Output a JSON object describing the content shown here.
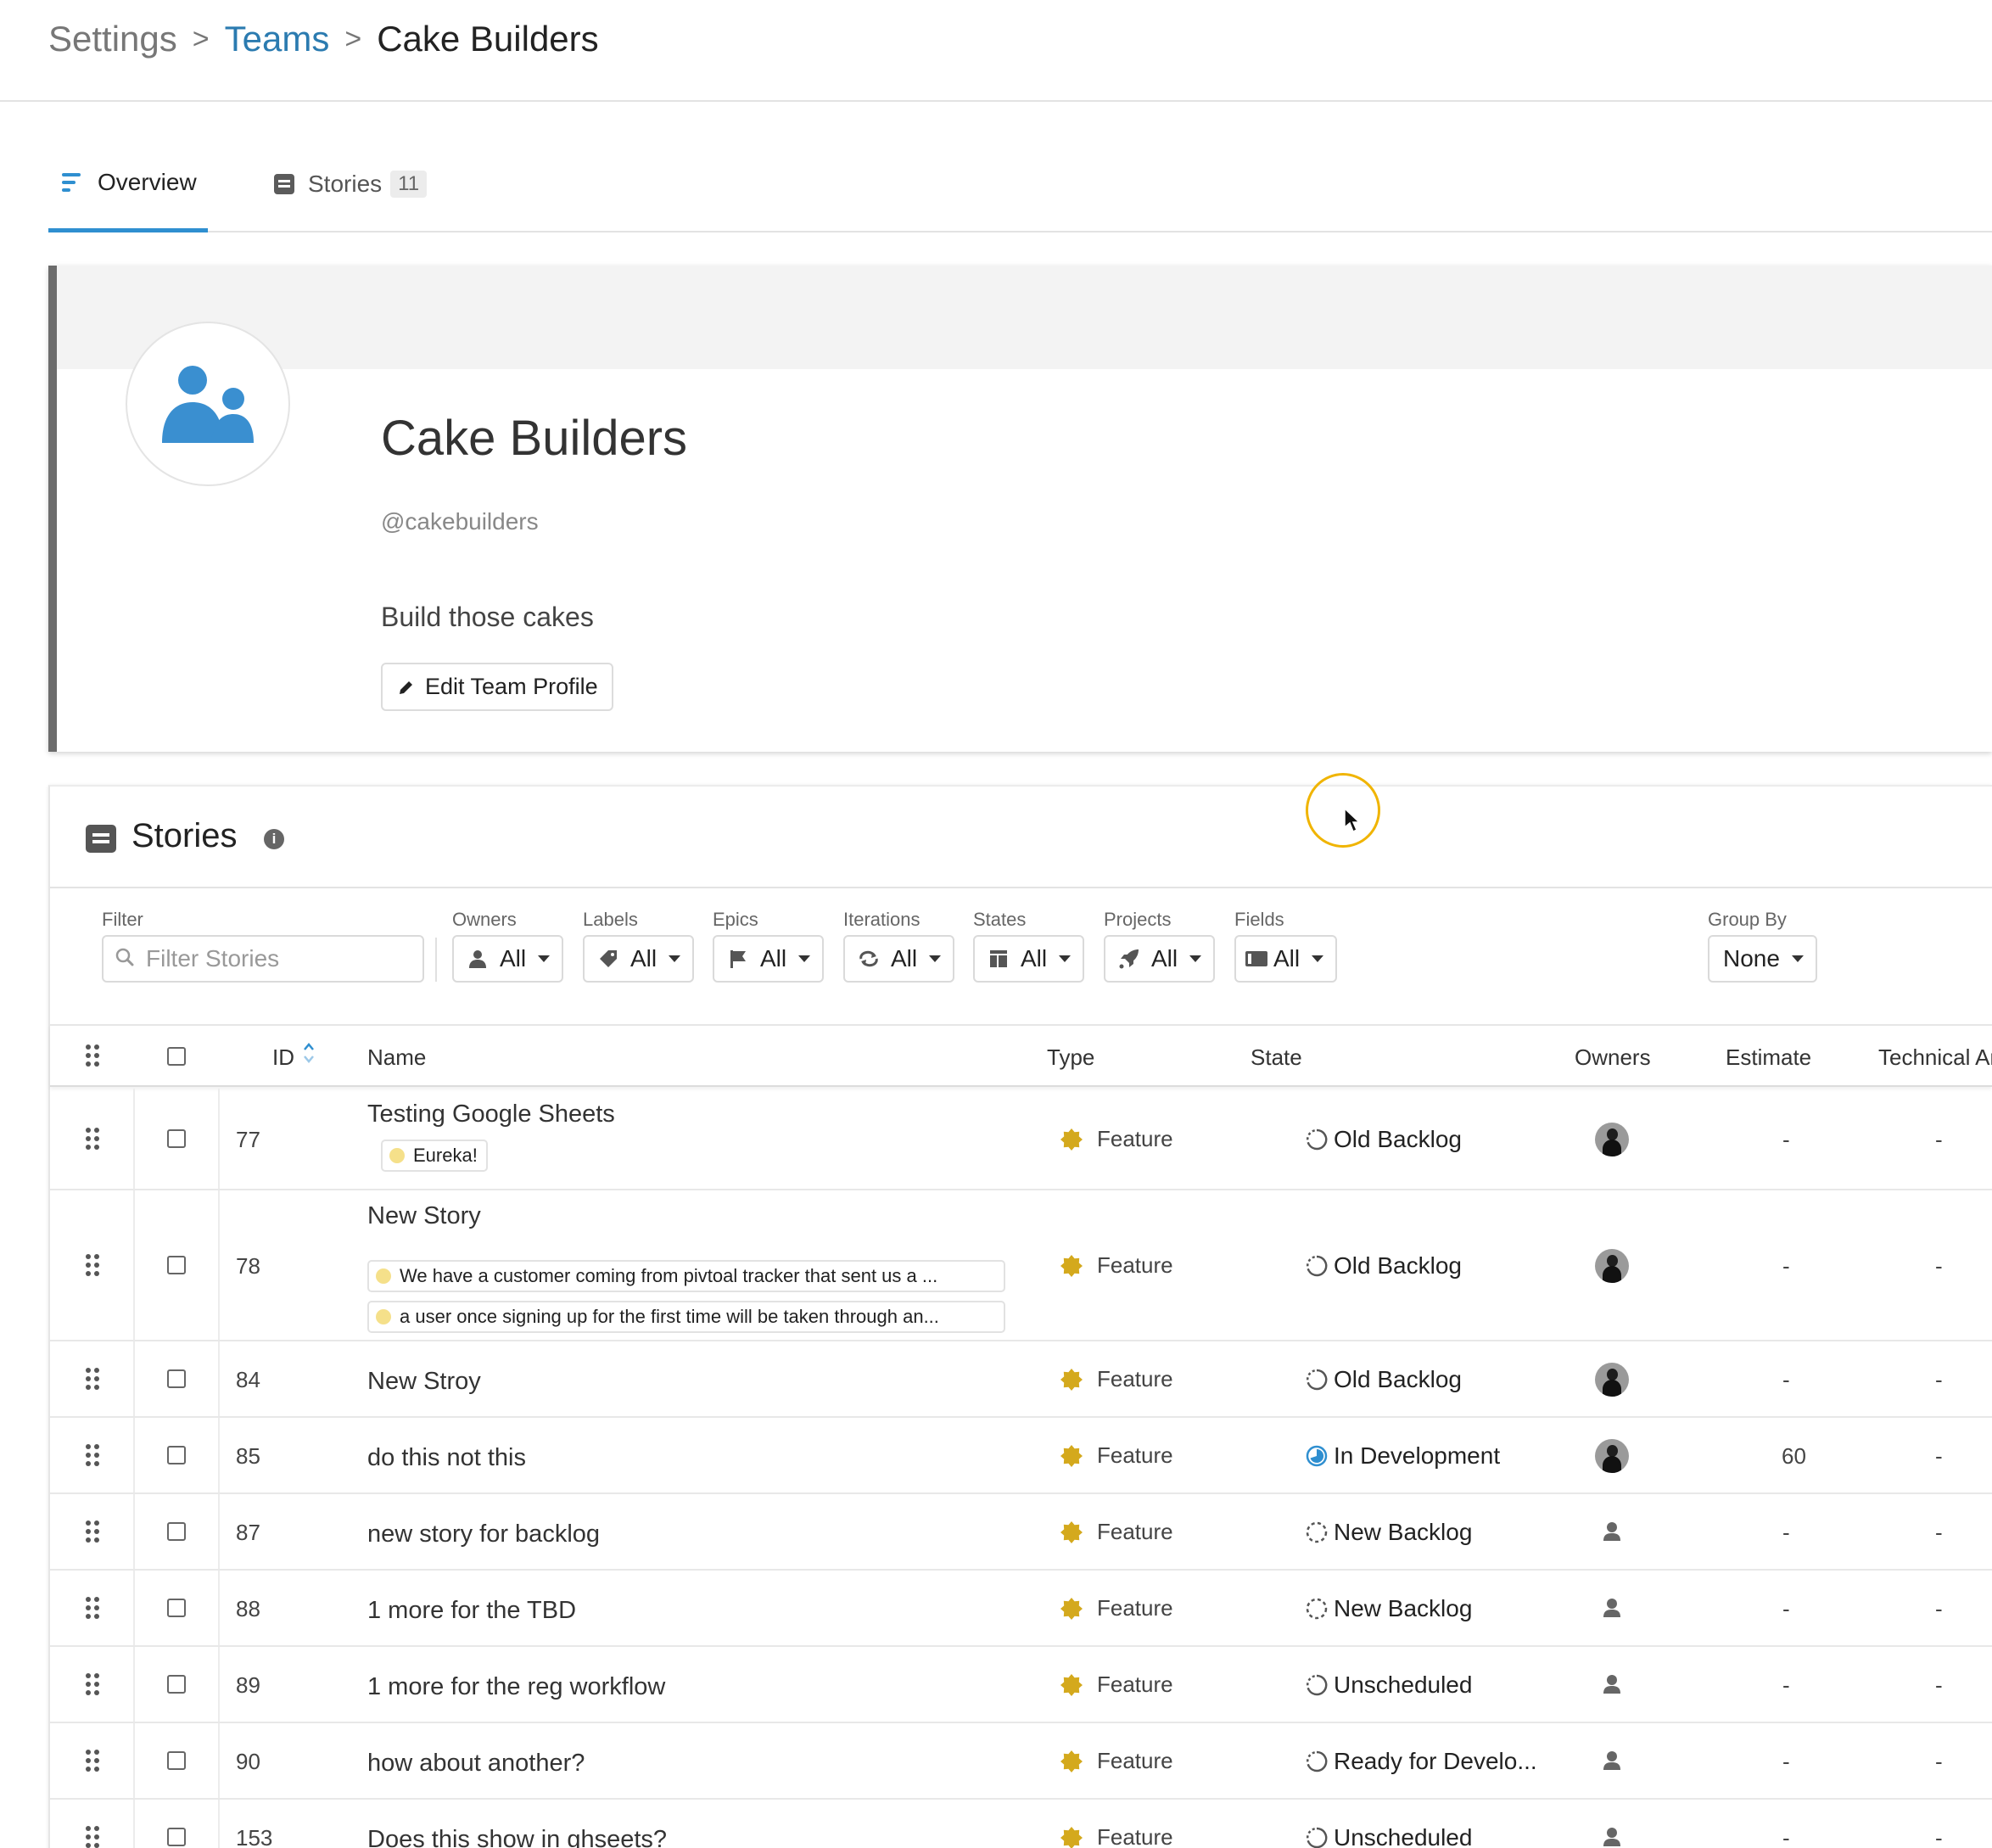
{
  "breadcrumb": {
    "settings": "Settings",
    "separator": ">",
    "teams": "Teams",
    "current": "Cake Builders"
  },
  "tabs": [
    {
      "label": "Overview",
      "icon": "lines-icon",
      "active": true
    },
    {
      "label": "Stories",
      "icon": "story-icon",
      "count": "11"
    }
  ],
  "team": {
    "name": "Cake Builders",
    "handle": "@cakebuilders",
    "description": "Build those cakes",
    "edit_label": "Edit Team Profile",
    "avatar_icon": "team-icon",
    "avatar_color": "#3a8fd0"
  },
  "stories": {
    "title": "Stories",
    "info_icon": "i",
    "filters": {
      "filter_label": "Filter",
      "filter_placeholder": "Filter Stories",
      "owners_label": "Owners",
      "owners_value": "All",
      "labels_label": "Labels",
      "labels_value": "All",
      "epics_label": "Epics",
      "epics_value": "All",
      "iterations_label": "Iterations",
      "iterations_value": "All",
      "states_label": "States",
      "states_value": "All",
      "projects_label": "Projects",
      "projects_value": "All",
      "fields_label": "Fields",
      "fields_value": "All",
      "groupby_label": "Group By",
      "groupby_value": "None"
    },
    "columns": {
      "id": "ID",
      "name": "Name",
      "type": "Type",
      "state": "State",
      "owners": "Owners",
      "estimate": "Estimate",
      "technical": "Technical Ar"
    },
    "rows": [
      {
        "id": "77",
        "name": "Testing Google Sheets",
        "labels": [
          "Eureka!"
        ],
        "type": "Feature",
        "state": "Old Backlog",
        "state_kind": "backlog",
        "owner": "photo",
        "estimate": "-",
        "technical": "-"
      },
      {
        "id": "78",
        "name": "New Story",
        "labels": [
          "We have a customer coming from pivtoal tracker that sent us a ...",
          "a user once signing up for the first time will be taken through an..."
        ],
        "type": "Feature",
        "state": "Old Backlog",
        "state_kind": "backlog",
        "owner": "photo",
        "estimate": "-",
        "technical": "-"
      },
      {
        "id": "84",
        "name": "New Stroy",
        "labels": [],
        "type": "Feature",
        "state": "Old Backlog",
        "state_kind": "backlog",
        "owner": "photo",
        "estimate": "-",
        "technical": "-"
      },
      {
        "id": "85",
        "name": "do this not this",
        "labels": [],
        "type": "Feature",
        "state": "In Development",
        "state_kind": "started",
        "owner": "photo",
        "estimate": "60",
        "technical": "-"
      },
      {
        "id": "87",
        "name": "new story for backlog",
        "labels": [],
        "type": "Feature",
        "state": "New Backlog",
        "state_kind": "dashed",
        "owner": "placeholder",
        "estimate": "-",
        "technical": "-"
      },
      {
        "id": "88",
        "name": "1 more for the TBD",
        "labels": [],
        "type": "Feature",
        "state": "New Backlog",
        "state_kind": "dashed",
        "owner": "placeholder",
        "estimate": "-",
        "technical": "-"
      },
      {
        "id": "89",
        "name": "1 more for the reg workflow",
        "labels": [],
        "type": "Feature",
        "state": "Unscheduled",
        "state_kind": "backlog",
        "owner": "placeholder",
        "estimate": "-",
        "technical": "-"
      },
      {
        "id": "90",
        "name": "how about another?",
        "labels": [],
        "type": "Feature",
        "state": "Ready for Develo...",
        "state_kind": "backlog",
        "owner": "placeholder",
        "estimate": "-",
        "technical": "-"
      },
      {
        "id": "153",
        "name": "Does this show in ghseets?",
        "labels": [],
        "type": "Feature",
        "state": "Unscheduled",
        "state_kind": "backlog",
        "owner": "placeholder",
        "estimate": "-",
        "technical": "-"
      }
    ]
  },
  "colors": {
    "accent": "#2f8fd0",
    "link": "#2b7bb0",
    "feature": "#d4a91d",
    "cursor_ring": "#f0b400"
  }
}
